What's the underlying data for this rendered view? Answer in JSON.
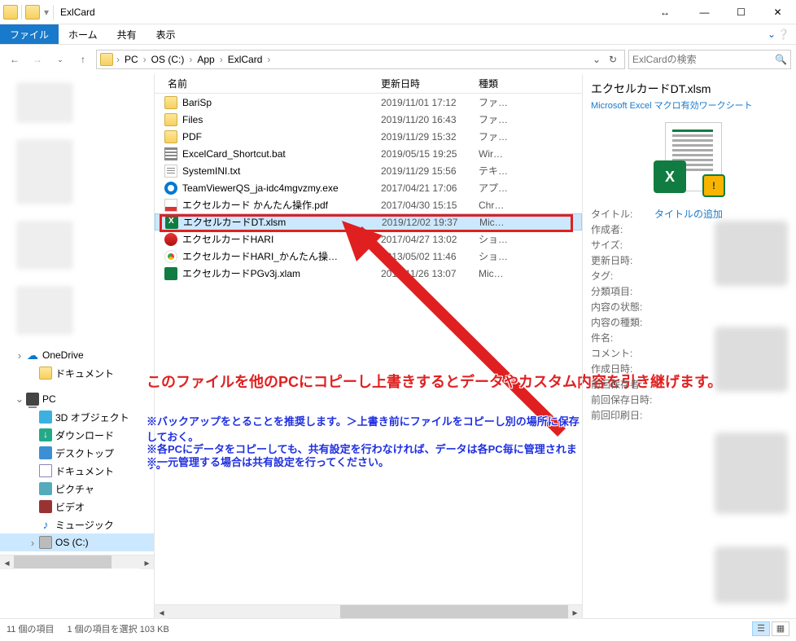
{
  "window": {
    "title": "ExlCard"
  },
  "ribbon": {
    "file": "ファイル",
    "home": "ホーム",
    "share": "共有",
    "view": "表示"
  },
  "breadcrumb": {
    "pc": "PC",
    "drive": "OS (C:)",
    "app": "App",
    "folder": "ExlCard"
  },
  "search": {
    "placeholder": "ExlCardの検索"
  },
  "columns": {
    "name": "名前",
    "date": "更新日時",
    "type": "種類"
  },
  "files": [
    {
      "name": "BariSp",
      "date": "2019/11/01 17:12",
      "type": "ファ…",
      "icon": "fold",
      "selected": false
    },
    {
      "name": "Files",
      "date": "2019/11/20 16:43",
      "type": "ファ…",
      "icon": "fold",
      "selected": false
    },
    {
      "name": "PDF",
      "date": "2019/11/29 15:32",
      "type": "ファ…",
      "icon": "fold",
      "selected": false
    },
    {
      "name": "ExcelCard_Shortcut.bat",
      "date": "2019/05/15 19:25",
      "type": "Wir…",
      "icon": "bat",
      "selected": false
    },
    {
      "name": "SystemINI.txt",
      "date": "2019/11/29 15:56",
      "type": "テキ…",
      "icon": "txt",
      "selected": false
    },
    {
      "name": "TeamViewerQS_ja-idc4mgvzmy.exe",
      "date": "2017/04/21 17:06",
      "type": "アプ…",
      "icon": "exe",
      "selected": false
    },
    {
      "name": "エクセルカード かんたん操作.pdf",
      "date": "2017/04/30 15:15",
      "type": "Chr…",
      "icon": "pdf",
      "selected": false
    },
    {
      "name": "エクセルカードDT.xlsm",
      "date": "2019/12/02 19:37",
      "type": "Mic…",
      "icon": "xlsm",
      "selected": true
    },
    {
      "name": "エクセルカードHARI",
      "date": "2017/04/27 13:02",
      "type": "ショ…",
      "icon": "lnk",
      "selected": false
    },
    {
      "name": "エクセルカードHARI_かんたん操…",
      "date": "2013/05/02 11:46",
      "type": "ショ…",
      "icon": "chr",
      "selected": false
    },
    {
      "name": "エクセルカードPGv3j.xlam",
      "date": "2019/11/26 13:07",
      "type": "Mic…",
      "icon": "xlam",
      "selected": false
    }
  ],
  "tree": {
    "onedrive": "OneDrive",
    "documents": "ドキュメント",
    "pc": "PC",
    "objects3d": "3D オブジェクト",
    "downloads": "ダウンロード",
    "desktop": "デスクトップ",
    "docs": "ドキュメント",
    "pictures": "ピクチャ",
    "videos": "ビデオ",
    "music": "ミュージック",
    "osdrive": "OS (C:)"
  },
  "details": {
    "title": "エクセルカードDT.xlsm",
    "subtitle": "Microsoft Excel マクロ有効ワークシート",
    "preview_badge": "X",
    "add_title": "タイトルの追加",
    "props": [
      {
        "label": "タイトル:",
        "value": ""
      },
      {
        "label": "作成者:",
        "value": ""
      },
      {
        "label": "サイズ:",
        "value": ""
      },
      {
        "label": "更新日時:",
        "value": ""
      },
      {
        "label": "タグ:",
        "value": ""
      },
      {
        "label": "分類項目:",
        "value": ""
      },
      {
        "label": "内容の状態:",
        "value": ""
      },
      {
        "label": "内容の種類:",
        "value": ""
      },
      {
        "label": "件名:",
        "value": ""
      },
      {
        "label": "コメント:",
        "value": ""
      },
      {
        "label": "作成日時:",
        "value": ""
      },
      {
        "label": "前回保存者:",
        "value": ""
      },
      {
        "label": "前回保存日時:",
        "value": ""
      },
      {
        "label": "前回印刷日:",
        "value": ""
      }
    ]
  },
  "overlay": {
    "red": "このファイルを他のPCにコピーし上書きするとデータやカスタム内容を引き継げます。",
    "blue1": "※バックアップをとることを推奨します。＞上書き前にファイルをコピーし別の場所に保存しておく。",
    "blue2": "※各PCにデータをコピーしても、共有設定を行わなければ、データは各PC毎に管理されます。",
    "blue3": "※一元管理する場合は共有設定を行ってください。"
  },
  "statusbar": {
    "count": "11 個の項目",
    "selected": "1 個の項目を選択 103 KB"
  }
}
